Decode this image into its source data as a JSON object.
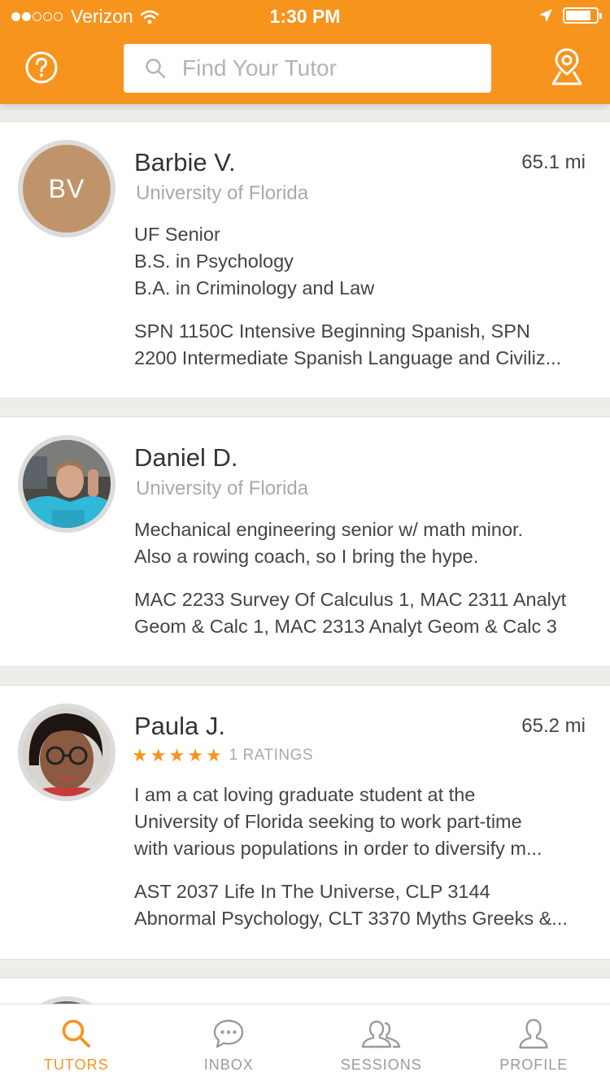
{
  "status_bar": {
    "carrier": "Verizon",
    "time": "1:30 PM"
  },
  "header": {
    "search_placeholder": "Find Your Tutor"
  },
  "tutors": [
    {
      "name": "Barbie V.",
      "initials": "BV",
      "distance": "65.1 mi",
      "school": "University of Florida",
      "bio_lines": [
        "UF Senior",
        "B.S. in Psychology",
        "B.A. in Criminology and Law"
      ],
      "course_lines": [
        "SPN 1150C Intensive Beginning Spanish, SPN",
        "2200 Intermediate Spanish Language and Civiliz..."
      ]
    },
    {
      "name": "Daniel D.",
      "school": "University of Florida",
      "bio_lines": [
        "Mechanical engineering senior w/ math minor.",
        "Also a rowing coach, so I bring the hype."
      ],
      "course_lines": [
        "MAC 2233 Survey Of Calculus 1, MAC 2311 Analyt",
        "Geom & Calc 1, MAC 2313 Analyt Geom & Calc 3"
      ]
    },
    {
      "name": "Paula J.",
      "distance": "65.2 mi",
      "rating_stars": 5,
      "rating_text": "1 RATINGS",
      "bio_lines": [
        "I am a cat loving graduate student at the",
        "University of Florida seeking to work part-time",
        "with various populations in order to diversify m..."
      ],
      "course_lines": [
        "AST 2037 Life In The Universe, CLP 3144",
        "Abnormal Psychology, CLT 3370 Myths Greeks &..."
      ]
    }
  ],
  "tabs": [
    {
      "label": "TUTORS",
      "icon": "search-icon",
      "active": true
    },
    {
      "label": "INBOX",
      "icon": "chat-bubble-icon",
      "active": false
    },
    {
      "label": "SESSIONS",
      "icon": "group-icon",
      "active": false
    },
    {
      "label": "PROFILE",
      "icon": "person-icon",
      "active": false
    }
  ],
  "colors": {
    "accent": "#f7941d",
    "avatar_bg": "#c0946b"
  }
}
